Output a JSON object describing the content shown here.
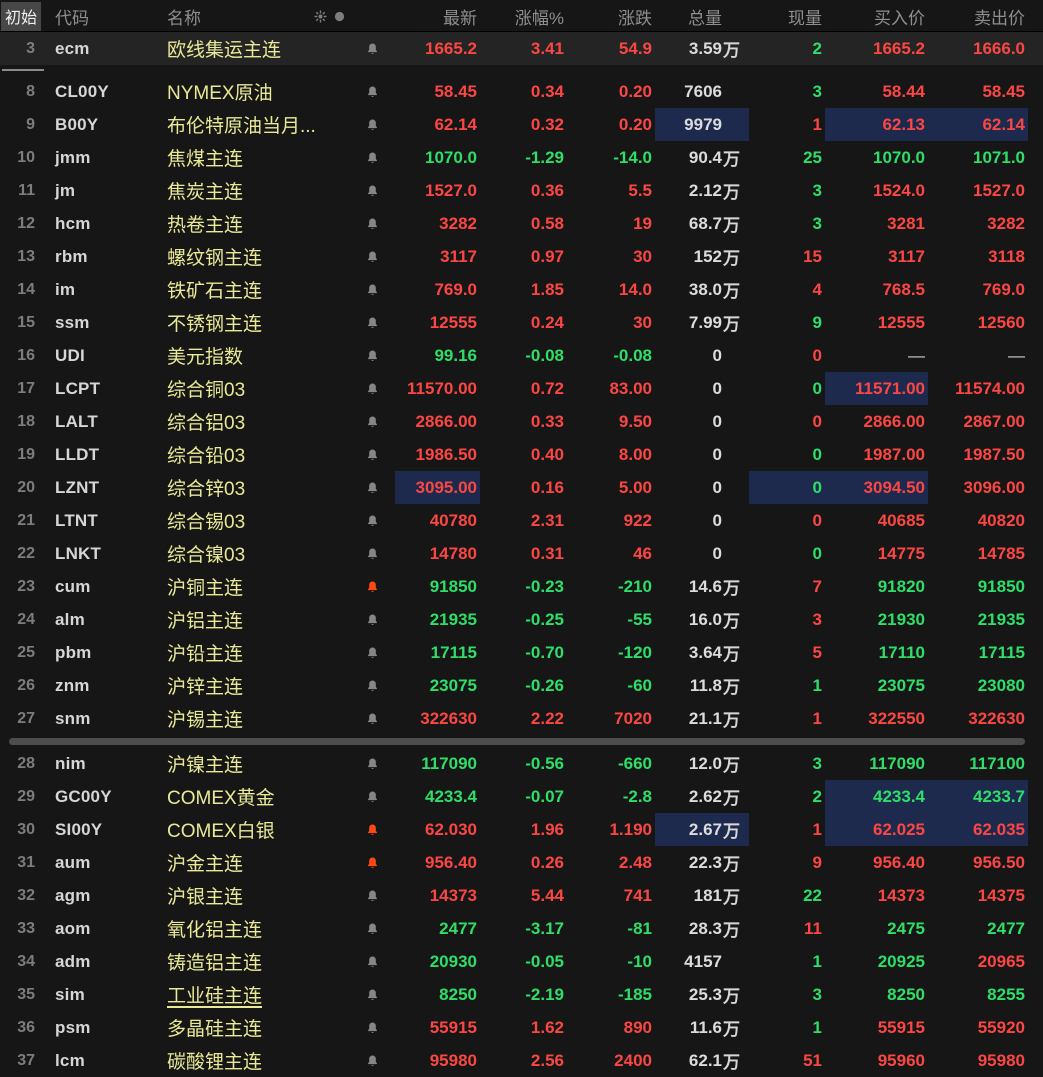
{
  "header": {
    "initial": "初始",
    "code": "代码",
    "name": "名称",
    "last": "最新",
    "pct": "涨幅%",
    "chg": "涨跌",
    "vol": "总量",
    "cur": "现量",
    "bid": "买入价",
    "ask": "卖出价",
    "icons": [
      "sun-icon",
      "dot-icon"
    ]
  },
  "wan_suffix": "万",
  "colors": {
    "up_red": "#fa4743",
    "down_green": "#2ede69",
    "name_yellow": "#e9e996",
    "volume_white": "#dcdcdc",
    "highlight_navy": "#1d2a4e",
    "alert_bell_orange": "#fd4a14",
    "background": "#161616"
  },
  "rows": [
    {
      "num": "3",
      "code": "ecm",
      "name": "欧线集运主连",
      "bell": "normal",
      "last": "1665.2",
      "last_c": "red",
      "pct": "3.41",
      "pct_c": "red",
      "chg": "54.9",
      "chg_c": "red",
      "vol": "3.59",
      "wan": true,
      "cur": "2",
      "cur_c": "green",
      "bid": "1665.2",
      "bid_c": "red",
      "ask": "1666.0",
      "ask_c": "red",
      "hl": [],
      "selected": true,
      "gap_after": true
    },
    {
      "num": "8",
      "code": "CL00Y",
      "name": "NYMEX原油",
      "bell": "normal",
      "last": "58.45",
      "last_c": "red",
      "pct": "0.34",
      "pct_c": "red",
      "chg": "0.20",
      "chg_c": "red",
      "vol": "7606",
      "wan": false,
      "cur": "3",
      "cur_c": "green",
      "bid": "58.44",
      "bid_c": "red",
      "ask": "58.45",
      "ask_c": "red",
      "hl": []
    },
    {
      "num": "9",
      "code": "B00Y",
      "name": "布伦特原油当月...",
      "bell": "normal",
      "last": "62.14",
      "last_c": "red",
      "pct": "0.32",
      "pct_c": "red",
      "chg": "0.20",
      "chg_c": "red",
      "vol": "9979",
      "wan": false,
      "cur": "1",
      "cur_c": "red",
      "bid": "62.13",
      "bid_c": "red",
      "ask": "62.14",
      "ask_c": "red",
      "hl": [
        "vol",
        "bid",
        "ask"
      ]
    },
    {
      "num": "10",
      "code": "jmm",
      "name": "焦煤主连",
      "bell": "normal",
      "last": "1070.0",
      "last_c": "green",
      "pct": "-1.29",
      "pct_c": "green",
      "chg": "-14.0",
      "chg_c": "green",
      "vol": "90.4",
      "wan": true,
      "cur": "25",
      "cur_c": "green",
      "bid": "1070.0",
      "bid_c": "green",
      "ask": "1071.0",
      "ask_c": "green",
      "hl": []
    },
    {
      "num": "11",
      "code": "jm",
      "name": "焦炭主连",
      "bell": "normal",
      "last": "1527.0",
      "last_c": "red",
      "pct": "0.36",
      "pct_c": "red",
      "chg": "5.5",
      "chg_c": "red",
      "vol": "2.12",
      "wan": true,
      "cur": "3",
      "cur_c": "green",
      "bid": "1524.0",
      "bid_c": "red",
      "ask": "1527.0",
      "ask_c": "red",
      "hl": []
    },
    {
      "num": "12",
      "code": "hcm",
      "name": "热卷主连",
      "bell": "normal",
      "last": "3282",
      "last_c": "red",
      "pct": "0.58",
      "pct_c": "red",
      "chg": "19",
      "chg_c": "red",
      "vol": "68.7",
      "wan": true,
      "cur": "3",
      "cur_c": "green",
      "bid": "3281",
      "bid_c": "red",
      "ask": "3282",
      "ask_c": "red",
      "hl": []
    },
    {
      "num": "13",
      "code": "rbm",
      "name": "螺纹钢主连",
      "bell": "normal",
      "last": "3117",
      "last_c": "red",
      "pct": "0.97",
      "pct_c": "red",
      "chg": "30",
      "chg_c": "red",
      "vol": "152",
      "wan": true,
      "cur": "15",
      "cur_c": "red",
      "bid": "3117",
      "bid_c": "red",
      "ask": "3118",
      "ask_c": "red",
      "hl": []
    },
    {
      "num": "14",
      "code": "im",
      "name": "铁矿石主连",
      "bell": "normal",
      "last": "769.0",
      "last_c": "red",
      "pct": "1.85",
      "pct_c": "red",
      "chg": "14.0",
      "chg_c": "red",
      "vol": "38.0",
      "wan": true,
      "cur": "4",
      "cur_c": "red",
      "bid": "768.5",
      "bid_c": "red",
      "ask": "769.0",
      "ask_c": "red",
      "hl": []
    },
    {
      "num": "15",
      "code": "ssm",
      "name": "不锈钢主连",
      "bell": "normal",
      "last": "12555",
      "last_c": "red",
      "pct": "0.24",
      "pct_c": "red",
      "chg": "30",
      "chg_c": "red",
      "vol": "7.99",
      "wan": true,
      "cur": "9",
      "cur_c": "green",
      "bid": "12555",
      "bid_c": "red",
      "ask": "12560",
      "ask_c": "red",
      "hl": []
    },
    {
      "num": "16",
      "code": "UDI",
      "name": "美元指数",
      "bell": "normal",
      "last": "99.16",
      "last_c": "green",
      "pct": "-0.08",
      "pct_c": "green",
      "chg": "-0.08",
      "chg_c": "green",
      "vol": "0",
      "wan": false,
      "cur": "0",
      "cur_c": "red",
      "bid": "—",
      "bid_c": "dash",
      "ask": "—",
      "ask_c": "dash",
      "hl": []
    },
    {
      "num": "17",
      "code": "LCPT",
      "name": "综合铜03",
      "bell": "normal",
      "last": "11570.00",
      "last_c": "red",
      "pct": "0.72",
      "pct_c": "red",
      "chg": "83.00",
      "chg_c": "red",
      "vol": "0",
      "wan": false,
      "cur": "0",
      "cur_c": "green",
      "bid": "11571.00",
      "bid_c": "red",
      "ask": "11574.00",
      "ask_c": "red",
      "hl": [
        "bid"
      ]
    },
    {
      "num": "18",
      "code": "LALT",
      "name": "综合铝03",
      "bell": "normal",
      "last": "2866.00",
      "last_c": "red",
      "pct": "0.33",
      "pct_c": "red",
      "chg": "9.50",
      "chg_c": "red",
      "vol": "0",
      "wan": false,
      "cur": "0",
      "cur_c": "red",
      "bid": "2866.00",
      "bid_c": "red",
      "ask": "2867.00",
      "ask_c": "red",
      "hl": []
    },
    {
      "num": "19",
      "code": "LLDT",
      "name": "综合铅03",
      "bell": "normal",
      "last": "1986.50",
      "last_c": "red",
      "pct": "0.40",
      "pct_c": "red",
      "chg": "8.00",
      "chg_c": "red",
      "vol": "0",
      "wan": false,
      "cur": "0",
      "cur_c": "green",
      "bid": "1987.00",
      "bid_c": "red",
      "ask": "1987.50",
      "ask_c": "red",
      "hl": []
    },
    {
      "num": "20",
      "code": "LZNT",
      "name": "综合锌03",
      "bell": "normal",
      "last": "3095.00",
      "last_c": "red",
      "pct": "0.16",
      "pct_c": "red",
      "chg": "5.00",
      "chg_c": "red",
      "vol": "0",
      "wan": false,
      "cur": "0",
      "cur_c": "green",
      "bid": "3094.50",
      "bid_c": "red",
      "ask": "3096.00",
      "ask_c": "red",
      "hl": [
        "last",
        "cur",
        "bid"
      ]
    },
    {
      "num": "21",
      "code": "LTNT",
      "name": "综合锡03",
      "bell": "normal",
      "last": "40780",
      "last_c": "red",
      "pct": "2.31",
      "pct_c": "red",
      "chg": "922",
      "chg_c": "red",
      "vol": "0",
      "wan": false,
      "cur": "0",
      "cur_c": "red",
      "bid": "40685",
      "bid_c": "red",
      "ask": "40820",
      "ask_c": "red",
      "hl": []
    },
    {
      "num": "22",
      "code": "LNKT",
      "name": "综合镍03",
      "bell": "normal",
      "last": "14780",
      "last_c": "red",
      "pct": "0.31",
      "pct_c": "red",
      "chg": "46",
      "chg_c": "red",
      "vol": "0",
      "wan": false,
      "cur": "0",
      "cur_c": "green",
      "bid": "14775",
      "bid_c": "red",
      "ask": "14785",
      "ask_c": "red",
      "hl": []
    },
    {
      "num": "23",
      "code": "cum",
      "name": "沪铜主连",
      "bell": "alert",
      "last": "91850",
      "last_c": "green",
      "pct": "-0.23",
      "pct_c": "green",
      "chg": "-210",
      "chg_c": "green",
      "vol": "14.6",
      "wan": true,
      "cur": "7",
      "cur_c": "red",
      "bid": "91820",
      "bid_c": "green",
      "ask": "91850",
      "ask_c": "green",
      "hl": []
    },
    {
      "num": "24",
      "code": "alm",
      "name": "沪铝主连",
      "bell": "normal",
      "last": "21935",
      "last_c": "green",
      "pct": "-0.25",
      "pct_c": "green",
      "chg": "-55",
      "chg_c": "green",
      "vol": "16.0",
      "wan": true,
      "cur": "3",
      "cur_c": "red",
      "bid": "21930",
      "bid_c": "green",
      "ask": "21935",
      "ask_c": "green",
      "hl": []
    },
    {
      "num": "25",
      "code": "pbm",
      "name": "沪铅主连",
      "bell": "normal",
      "last": "17115",
      "last_c": "green",
      "pct": "-0.70",
      "pct_c": "green",
      "chg": "-120",
      "chg_c": "green",
      "vol": "3.64",
      "wan": true,
      "cur": "5",
      "cur_c": "red",
      "bid": "17110",
      "bid_c": "green",
      "ask": "17115",
      "ask_c": "green",
      "hl": []
    },
    {
      "num": "26",
      "code": "znm",
      "name": "沪锌主连",
      "bell": "normal",
      "last": "23075",
      "last_c": "green",
      "pct": "-0.26",
      "pct_c": "green",
      "chg": "-60",
      "chg_c": "green",
      "vol": "11.8",
      "wan": true,
      "cur": "1",
      "cur_c": "green",
      "bid": "23075",
      "bid_c": "green",
      "ask": "23080",
      "ask_c": "green",
      "hl": []
    },
    {
      "num": "27",
      "code": "snm",
      "name": "沪锡主连",
      "bell": "normal",
      "last": "322630",
      "last_c": "red",
      "pct": "2.22",
      "pct_c": "red",
      "chg": "7020",
      "chg_c": "red",
      "vol": "21.1",
      "wan": true,
      "cur": "1",
      "cur_c": "red",
      "bid": "322550",
      "bid_c": "red",
      "ask": "322630",
      "ask_c": "red",
      "hl": [],
      "divider_after": true
    },
    {
      "num": "28",
      "code": "nim",
      "name": "沪镍主连",
      "bell": "normal",
      "last": "117090",
      "last_c": "green",
      "pct": "-0.56",
      "pct_c": "green",
      "chg": "-660",
      "chg_c": "green",
      "vol": "12.0",
      "wan": true,
      "cur": "3",
      "cur_c": "green",
      "bid": "117090",
      "bid_c": "green",
      "ask": "117100",
      "ask_c": "green",
      "hl": []
    },
    {
      "num": "29",
      "code": "GC00Y",
      "name": "COMEX黄金",
      "bell": "normal",
      "last": "4233.4",
      "last_c": "green",
      "pct": "-0.07",
      "pct_c": "green",
      "chg": "-2.8",
      "chg_c": "green",
      "vol": "2.62",
      "wan": true,
      "cur": "2",
      "cur_c": "green",
      "bid": "4233.4",
      "bid_c": "green",
      "ask": "4233.7",
      "ask_c": "green",
      "hl": [
        "bid",
        "ask"
      ]
    },
    {
      "num": "30",
      "code": "SI00Y",
      "name": "COMEX白银",
      "bell": "alert",
      "last": "62.030",
      "last_c": "red",
      "pct": "1.96",
      "pct_c": "red",
      "chg": "1.190",
      "chg_c": "red",
      "vol": "2.67",
      "wan": true,
      "cur": "1",
      "cur_c": "red",
      "bid": "62.025",
      "bid_c": "red",
      "ask": "62.035",
      "ask_c": "red",
      "hl": [
        "vol",
        "bid",
        "ask"
      ]
    },
    {
      "num": "31",
      "code": "aum",
      "name": "沪金主连",
      "bell": "alert",
      "last": "956.40",
      "last_c": "red",
      "pct": "0.26",
      "pct_c": "red",
      "chg": "2.48",
      "chg_c": "red",
      "vol": "22.3",
      "wan": true,
      "cur": "9",
      "cur_c": "red",
      "bid": "956.40",
      "bid_c": "red",
      "ask": "956.50",
      "ask_c": "red",
      "hl": []
    },
    {
      "num": "32",
      "code": "agm",
      "name": "沪银主连",
      "bell": "normal",
      "last": "14373",
      "last_c": "red",
      "pct": "5.44",
      "pct_c": "red",
      "chg": "741",
      "chg_c": "red",
      "vol": "181",
      "wan": true,
      "cur": "22",
      "cur_c": "green",
      "bid": "14373",
      "bid_c": "red",
      "ask": "14375",
      "ask_c": "red",
      "hl": []
    },
    {
      "num": "33",
      "code": "aom",
      "name": "氧化铝主连",
      "bell": "normal",
      "last": "2477",
      "last_c": "green",
      "pct": "-3.17",
      "pct_c": "green",
      "chg": "-81",
      "chg_c": "green",
      "vol": "28.3",
      "wan": true,
      "cur": "11",
      "cur_c": "red",
      "bid": "2475",
      "bid_c": "green",
      "ask": "2477",
      "ask_c": "green",
      "hl": []
    },
    {
      "num": "34",
      "code": "adm",
      "name": "铸造铝主连",
      "bell": "normal",
      "last": "20930",
      "last_c": "green",
      "pct": "-0.05",
      "pct_c": "green",
      "chg": "-10",
      "chg_c": "green",
      "vol": "4157",
      "wan": false,
      "cur": "1",
      "cur_c": "green",
      "bid": "20925",
      "bid_c": "green",
      "ask": "20965",
      "ask_c": "red",
      "hl": []
    },
    {
      "num": "35",
      "code": "sim",
      "name": "工业硅主连",
      "bell": "normal",
      "name_underline": true,
      "last": "8250",
      "last_c": "green",
      "pct": "-2.19",
      "pct_c": "green",
      "chg": "-185",
      "chg_c": "green",
      "vol": "25.3",
      "wan": true,
      "cur": "3",
      "cur_c": "green",
      "bid": "8250",
      "bid_c": "green",
      "ask": "8255",
      "ask_c": "green",
      "hl": []
    },
    {
      "num": "36",
      "code": "psm",
      "name": "多晶硅主连",
      "bell": "normal",
      "last": "55915",
      "last_c": "red",
      "pct": "1.62",
      "pct_c": "red",
      "chg": "890",
      "chg_c": "red",
      "vol": "11.6",
      "wan": true,
      "cur": "1",
      "cur_c": "green",
      "bid": "55915",
      "bid_c": "red",
      "ask": "55920",
      "ask_c": "red",
      "hl": []
    },
    {
      "num": "37",
      "code": "lcm",
      "name": "碳酸锂主连",
      "bell": "normal",
      "last": "95980",
      "last_c": "red",
      "pct": "2.56",
      "pct_c": "red",
      "chg": "2400",
      "chg_c": "red",
      "vol": "62.1",
      "wan": true,
      "cur": "51",
      "cur_c": "red",
      "bid": "95960",
      "bid_c": "red",
      "ask": "95980",
      "ask_c": "red",
      "hl": []
    }
  ]
}
